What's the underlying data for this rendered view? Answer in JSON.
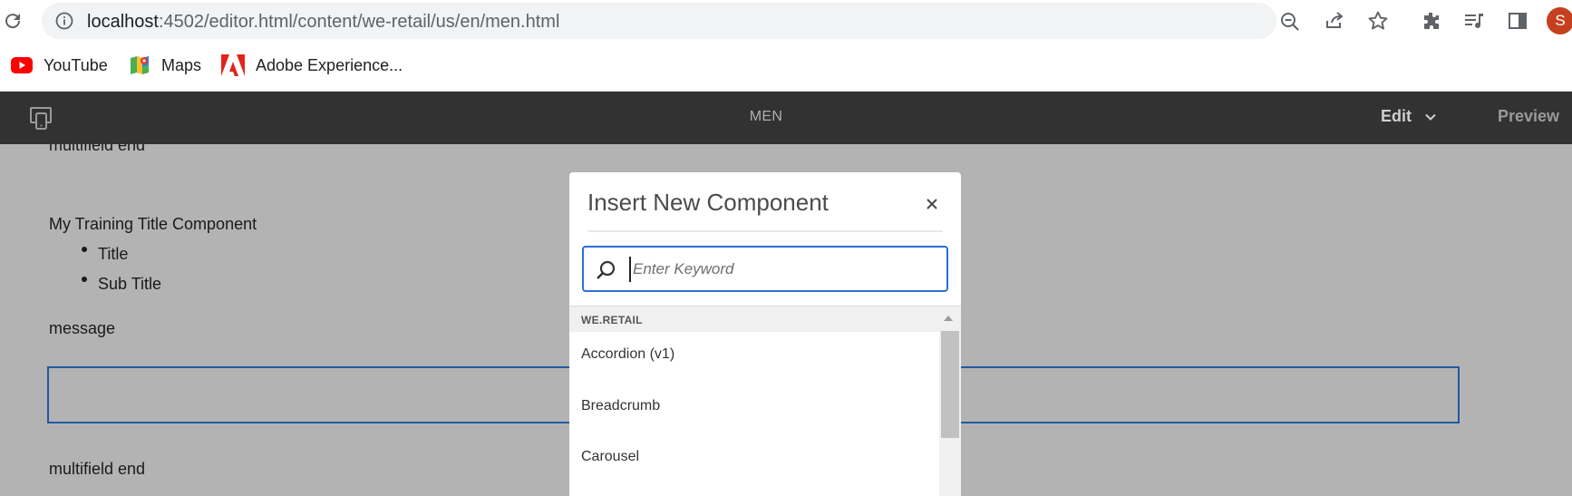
{
  "browser": {
    "url_host": "localhost",
    "url_path": ":4502/editor.html/content/we-retail/us/en/men.html",
    "profile_initial": "S"
  },
  "bookmarks": [
    {
      "label": "YouTube",
      "icon": "youtube-icon"
    },
    {
      "label": "Maps",
      "icon": "maps-icon"
    },
    {
      "label": "Adobe Experience...",
      "icon": "adobe-icon"
    }
  ],
  "editor": {
    "page_title": "MEN",
    "mode_label": "Edit",
    "preview_label": "Preview"
  },
  "canvas": {
    "top_text": "multifield end",
    "component_title": "My Training Title Component",
    "bullets": [
      "Title",
      "Sub Title"
    ],
    "message": "message",
    "bottom_text": "multifield end"
  },
  "dialog": {
    "title": "Insert New Component",
    "search_placeholder": "Enter Keyword",
    "group_label": "WE.RETAIL",
    "components": [
      "Accordion (v1)",
      "Breadcrumb",
      "Carousel"
    ]
  },
  "colors": {
    "editor_bar": "#323232",
    "overlay": "#b3b3b3",
    "focus_blue": "#2b6fd6",
    "avatar": "#c5401f"
  }
}
